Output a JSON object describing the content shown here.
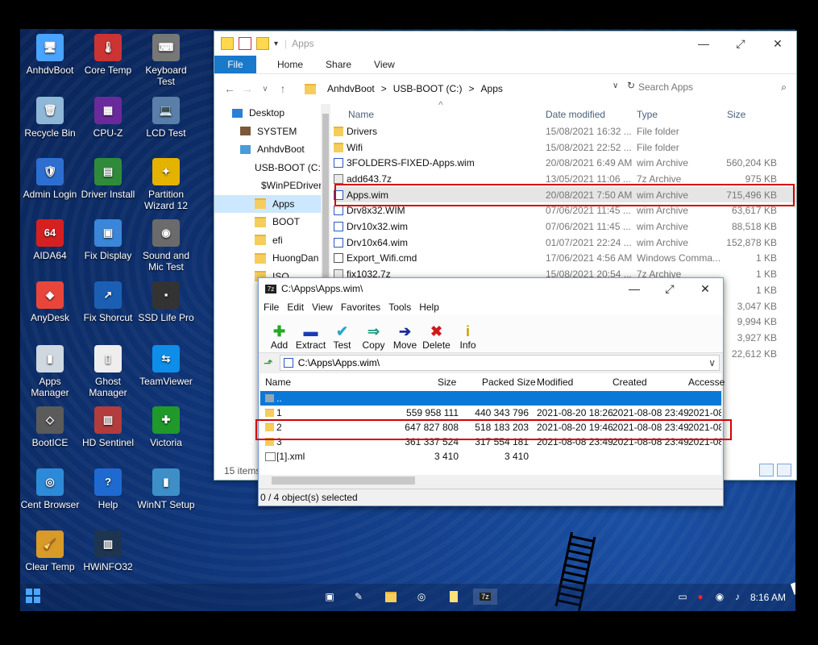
{
  "desktop": {
    "icons": [
      {
        "label": "AnhdvBoot",
        "color": "#4aa3ff",
        "glyph": "🖥"
      },
      {
        "label": "Core Temp",
        "color": "#cc3333",
        "glyph": "🌡"
      },
      {
        "label": "Keyboard Test",
        "color": "#777777",
        "glyph": "⌨"
      },
      {
        "label": "Recycle Bin",
        "color": "#8fb8d8",
        "glyph": "🗑"
      },
      {
        "label": "CPU-Z",
        "color": "#6a2a9c",
        "glyph": "▦"
      },
      {
        "label": "LCD Test",
        "color": "#5a7fa8",
        "glyph": "💻"
      },
      {
        "label": "Admin Login",
        "color": "#2d6fd1",
        "glyph": "🛡"
      },
      {
        "label": "Driver Install",
        "color": "#2f8b3a",
        "glyph": "▤"
      },
      {
        "label": "Partition Wizard 12",
        "color": "#e3b300",
        "glyph": "✦"
      },
      {
        "label": "AIDA64",
        "color": "#d62020",
        "glyph": "64"
      },
      {
        "label": "Fix Display",
        "color": "#3b86d8",
        "glyph": "▣"
      },
      {
        "label": "Sound and Mic Test",
        "color": "#6b6b6b",
        "glyph": "◉"
      },
      {
        "label": "AnyDesk",
        "color": "#e8463a",
        "glyph": "◆"
      },
      {
        "label": "Fix Shorcut",
        "color": "#1b5fb5",
        "glyph": "↗"
      },
      {
        "label": "SSD Life Pro",
        "color": "#333333",
        "glyph": "▪"
      },
      {
        "label": "Apps Manager",
        "color": "#cfd8e0",
        "glyph": "▮"
      },
      {
        "label": "Ghost Manager",
        "color": "#eeeeee",
        "glyph": "▯"
      },
      {
        "label": "TeamViewer",
        "color": "#0e8ee9",
        "glyph": "⇆"
      },
      {
        "label": "BootICE",
        "color": "#5b5b5b",
        "glyph": "◇"
      },
      {
        "label": "HD Sentinel",
        "color": "#b33c3c",
        "glyph": "▥"
      },
      {
        "label": "Victoria",
        "color": "#1f9a2a",
        "glyph": "✚"
      },
      {
        "label": "Cent Browser",
        "color": "#2d8ad8",
        "glyph": "◎"
      },
      {
        "label": "Help",
        "color": "#1e6ad1",
        "glyph": "?"
      },
      {
        "label": "WinNT Setup",
        "color": "#3e8fc8",
        "glyph": "▮"
      },
      {
        "label": "Clear Temp",
        "color": "#d99a28",
        "glyph": "🧹"
      },
      {
        "label": "HWiNFO32",
        "color": "#1d3550",
        "glyph": "▥"
      }
    ]
  },
  "explorer": {
    "title": "Apps",
    "ribbon": {
      "file": "File",
      "tabs": [
        "Home",
        "Share",
        "View"
      ]
    },
    "address": [
      "AnhdvBoot",
      ">",
      "USB-BOOT (C:)",
      ">",
      "Apps"
    ],
    "search_placeholder": "Search Apps",
    "nav": [
      {
        "label": "Desktop",
        "indent": 0,
        "kind": "desktop"
      },
      {
        "label": "SYSTEM",
        "indent": 10,
        "kind": "user"
      },
      {
        "label": "AnhdvBoot",
        "indent": 10,
        "kind": "pc"
      },
      {
        "label": "USB-BOOT (C:)",
        "indent": 20,
        "kind": "drive"
      },
      {
        "label": "$WinPEDriver",
        "indent": 28,
        "kind": "folder"
      },
      {
        "label": "Apps",
        "indent": 28,
        "kind": "folder",
        "selected": true
      },
      {
        "label": "BOOT",
        "indent": 28,
        "kind": "folder"
      },
      {
        "label": "efi",
        "indent": 28,
        "kind": "folder"
      },
      {
        "label": "HuongDan",
        "indent": 28,
        "kind": "folder"
      },
      {
        "label": "ISO",
        "indent": 28,
        "kind": "folder"
      }
    ],
    "columns": {
      "name": "Name",
      "date": "Date modified",
      "type": "Type",
      "size": "Size"
    },
    "files": [
      {
        "name": "Drivers",
        "date": "15/08/2021 16:32 ...",
        "type": "File folder",
        "size": "",
        "icon": "folder"
      },
      {
        "name": "Wifi",
        "date": "15/08/2021 22:52 ...",
        "type": "File folder",
        "size": "",
        "icon": "folder"
      },
      {
        "name": "3FOLDERS-FIXED-Apps.wim",
        "date": "20/08/2021 6:49 AM",
        "type": "wim Archive",
        "size": "560,204 KB",
        "icon": "wim"
      },
      {
        "name": "add643.7z",
        "date": "13/05/2021 11:06 ...",
        "type": "7z Archive",
        "size": "975 KB",
        "icon": "zip"
      },
      {
        "name": "Apps.wim",
        "date": "20/08/2021 7:50 AM",
        "type": "wim Archive",
        "size": "715,496 KB",
        "icon": "wim",
        "selected": true
      },
      {
        "name": "Drv8x32.WIM",
        "date": "07/06/2021 11:45 ...",
        "type": "wim Archive",
        "size": "63,617 KB",
        "icon": "wim"
      },
      {
        "name": "Drv10x32.wim",
        "date": "07/06/2021 11:45 ...",
        "type": "wim Archive",
        "size": "88,518 KB",
        "icon": "wim"
      },
      {
        "name": "Drv10x64.wim",
        "date": "01/07/2021 22:24 ...",
        "type": "wim Archive",
        "size": "152,878 KB",
        "icon": "wim"
      },
      {
        "name": "Export_Wifi.cmd",
        "date": "17/06/2021 4:56 AM",
        "type": "Windows Comma...",
        "size": "1 KB",
        "icon": "cmd"
      },
      {
        "name": "fix1032.7z",
        "date": "15/08/2021 20:54 ...",
        "type": "7z Archive",
        "size": "1 KB",
        "icon": "zip"
      },
      {
        "name": "",
        "date": "",
        "type": "",
        "size": "1 KB",
        "icon": ""
      },
      {
        "name": "",
        "date": "",
        "type": "",
        "size": "3,047 KB",
        "icon": ""
      },
      {
        "name": "",
        "date": "",
        "type": "",
        "size": "9,994 KB",
        "icon": ""
      },
      {
        "name": "",
        "date": "",
        "type": "",
        "size": "3,927 KB",
        "icon": ""
      },
      {
        "name": "",
        "date": "",
        "type": "",
        "size": "22,612 KB",
        "icon": ""
      }
    ],
    "status": "15 items"
  },
  "zip": {
    "title": "C:\\Apps\\Apps.wim\\",
    "menu": [
      "File",
      "Edit",
      "View",
      "Favorites",
      "Tools",
      "Help"
    ],
    "toolbar": [
      {
        "label": "Add",
        "glyph": "✚",
        "color": "#22aa22"
      },
      {
        "label": "Extract",
        "glyph": "▬",
        "color": "#1a3bb8"
      },
      {
        "label": "Test",
        "glyph": "✔",
        "color": "#2aa6c8"
      },
      {
        "label": "Copy",
        "glyph": "⇒",
        "color": "#1e9a80"
      },
      {
        "label": "Move",
        "glyph": "➔",
        "color": "#1c2c9a"
      },
      {
        "label": "Delete",
        "glyph": "✖",
        "color": "#d11a1a"
      },
      {
        "label": "Info",
        "glyph": "i",
        "color": "#c9a100"
      }
    ],
    "path": "C:\\Apps\\Apps.wim\\",
    "columns": {
      "name": "Name",
      "size": "Size",
      "packed": "Packed Size",
      "modified": "Modified",
      "created": "Created",
      "accessed": "Accesse"
    },
    "rows": [
      {
        "name": "..",
        "size": "",
        "packed": "",
        "modified": "",
        "created": "",
        "accessed": "",
        "highlight": true
      },
      {
        "name": "1",
        "size": "559 958 111",
        "packed": "440 343 796",
        "modified": "2021-08-20 18:26",
        "created": "2021-08-08 23:49",
        "accessed": "2021-08-"
      },
      {
        "name": "2",
        "size": "647 827 808",
        "packed": "518 183 203",
        "modified": "2021-08-20 19:46",
        "created": "2021-08-08 23:49",
        "accessed": "2021-08-"
      },
      {
        "name": "3",
        "size": "361 337 524",
        "packed": "317 554 181",
        "modified": "2021-08-08 23:49",
        "created": "2021-08-08 23:49",
        "accessed": "2021-08-"
      },
      {
        "name": "[1].xml",
        "size": "3 410",
        "packed": "3 410",
        "modified": "",
        "created": "",
        "accessed": ""
      }
    ],
    "status": "0 / 4 object(s) selected"
  },
  "taskbar": {
    "clock": "8:16 AM"
  }
}
